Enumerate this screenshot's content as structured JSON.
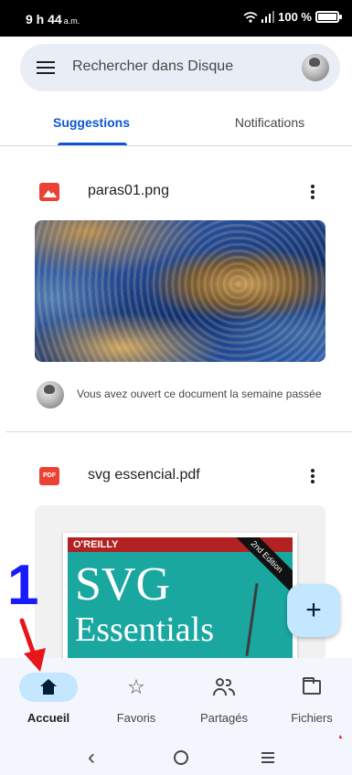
{
  "status_bar": {
    "time": "9 h 44",
    "time_suffix": "a.m.",
    "battery_text": "100 %",
    "battery_level": 1.0
  },
  "search": {
    "placeholder": "Rechercher dans Disque"
  },
  "tabs": [
    {
      "label": "Suggestions",
      "active": true
    },
    {
      "label": "Notifications",
      "active": false
    }
  ],
  "files": [
    {
      "name": "paras01.png",
      "type_icon": "image-icon",
      "activity": "Vous avez ouvert ce document la semaine passée"
    },
    {
      "name": "svg essencial.pdf",
      "type_icon": "pdf-icon",
      "icon_text": "PDF"
    }
  ],
  "pdf_cover": {
    "publisher": "O'REILLY",
    "edition": "2nd Edition",
    "title_line1": "SVG",
    "title_line2": "Essentials"
  },
  "fab": {
    "icon": "plus-icon",
    "symbol": "+"
  },
  "annotation": {
    "number": "1",
    "color": "#1a1aff",
    "arrow_color": "#e8161b"
  },
  "bottom_nav": [
    {
      "label": "Accueil",
      "icon": "home-icon",
      "active": true
    },
    {
      "label": "Favoris",
      "icon": "star-icon",
      "active": false
    },
    {
      "label": "Partagés",
      "icon": "shared-icon",
      "active": false
    },
    {
      "label": "Fichiers",
      "icon": "folder-icon",
      "active": false
    }
  ],
  "system_nav": {
    "back": "‹",
    "home": "home-circle-icon",
    "recent": "recents-icon"
  },
  "colors": {
    "accent": "#0b57d0",
    "fab_bg": "#c2e7ff",
    "file_red": "#ea4335",
    "nav_bg": "#f3f6fc"
  }
}
